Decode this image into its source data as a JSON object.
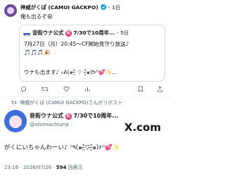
{
  "tweet1": {
    "name": "神威がくぽ (CAMUI GACKPO)",
    "age": "1日",
    "text": "俺も出るぞ😆"
  },
  "quote": {
    "name": "音街ウナ公式",
    "badge": "祝",
    "name_suffix": "7/30で10周年...",
    "age": "5日",
    "line1": "7月27日（月）20:45〜CF開始見守り放送♪",
    "line2_emojis": "🎵🎵🎵🎉",
    "line3": "ウナも出ます♪ ₍₍ᕕ(๑˃̶͈̀ ⌔ ˂̶͈́๑)ᕗ⁾⁾💕✨..."
  },
  "retweet_label": "神威がくぽ (CAMUI GACKPO)さんがリポスト",
  "tweet2": {
    "name": "音街ウナ公式",
    "badge": "祝",
    "name_suffix": "7/30で10周年...",
    "handle": "@otomachiuna",
    "text": "がくにいちゃんわーい♪ ⁾⁾٩(๑˃̶͈̀▽˂̶͈́๑)۶⁾⁾💕✨",
    "timestamp": "23:16 · 2026/07/26 · ",
    "views_count": "594",
    "views_label": " 回表示"
  },
  "brand": {
    "logo_text": "X.com"
  },
  "colors": {
    "verified": "#1d9bf0",
    "badge": "#e0245e",
    "muted": "#536471"
  },
  "icons": [
    "reply-icon",
    "retweet-icon",
    "like-icon",
    "views-icon",
    "bookmark-icon",
    "share-icon",
    "x-logo-icon"
  ]
}
